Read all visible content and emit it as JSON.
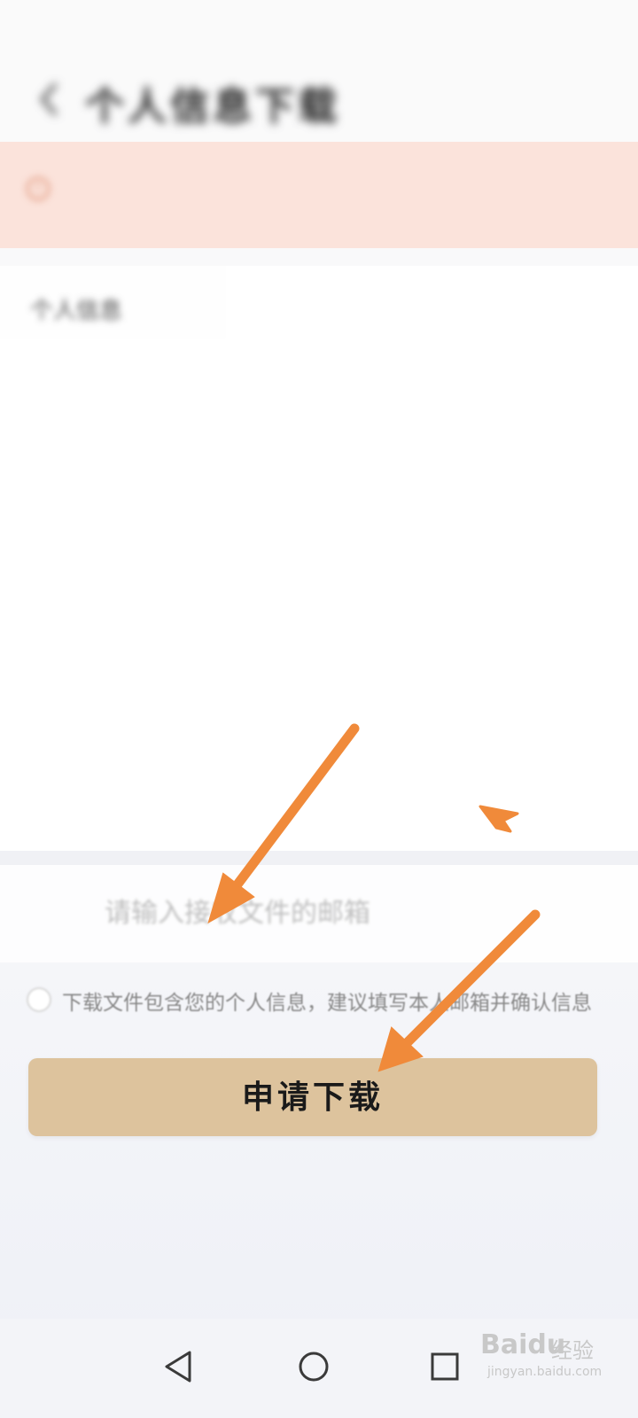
{
  "status_bar": {
    "left": "",
    "right": ""
  },
  "header": {
    "title": "个人信息下载"
  },
  "warning": {
    "text": ""
  },
  "info": {
    "section_title": "个人信息",
    "section_hint": "",
    "rows": [
      {
        "label": "",
        "value": ""
      },
      {
        "label": "",
        "value": ""
      },
      {
        "label": "",
        "value": ""
      },
      {
        "label": "",
        "value": ""
      },
      {
        "label": "",
        "value": ""
      },
      {
        "label": "",
        "value": ""
      }
    ]
  },
  "email": {
    "label": "",
    "placeholder": "请输入接收文件的邮箱"
  },
  "agreement": {
    "text": "下载文件包含您的个人信息，建议填写本人邮箱并确认信息"
  },
  "actions": {
    "apply_label": "申请下载"
  },
  "watermark": {
    "brand": "Baidu",
    "suffix": "经验",
    "url": "jingyan.baidu.com"
  },
  "colors": {
    "accent_button": "#ddc39d",
    "warning_bg": "#fbe3db",
    "warning_text": "#c9623f",
    "arrow": "#f08a3a"
  },
  "icons": {
    "back": "chevron-left-icon",
    "nav_back": "triangle-back-icon",
    "nav_home": "circle-home-icon",
    "nav_recent": "square-recents-icon"
  }
}
